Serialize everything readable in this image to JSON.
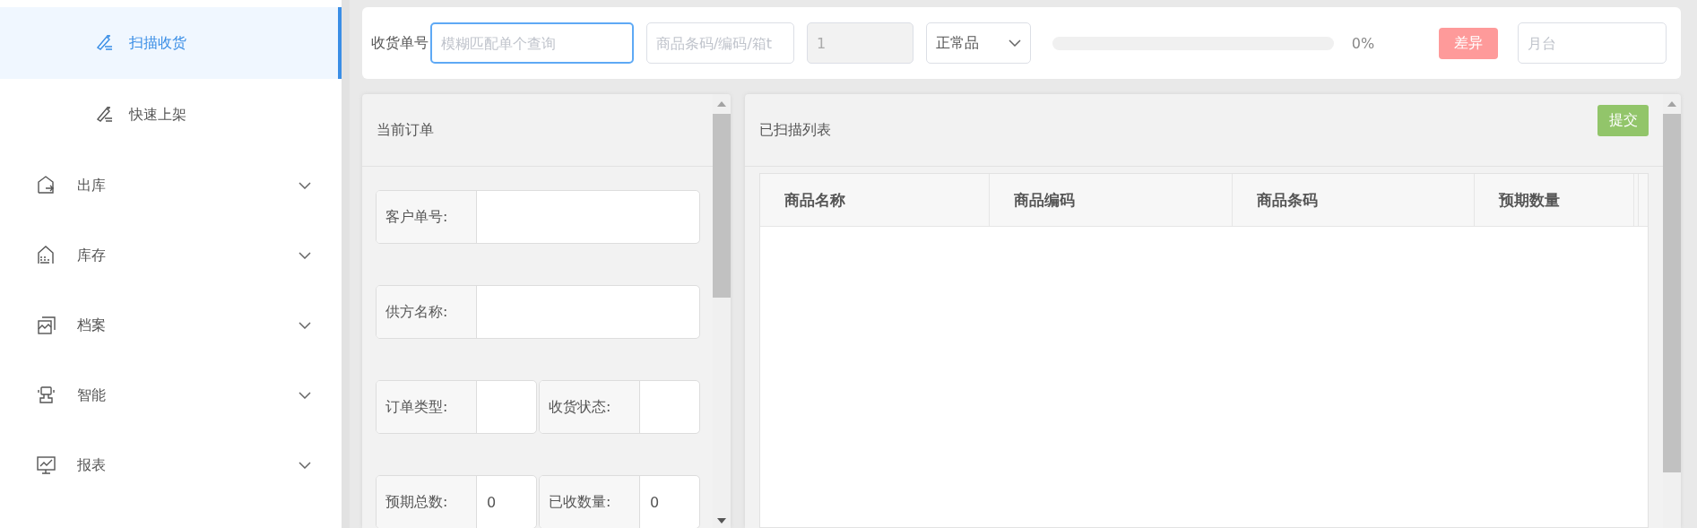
{
  "sidebar": {
    "items": [
      {
        "kind": "sub",
        "label": "扫描收货",
        "selected": true
      },
      {
        "kind": "sub",
        "label": "快速上架",
        "selected": false
      },
      {
        "kind": "group",
        "label": "出库",
        "selected": false,
        "expanded": false
      },
      {
        "kind": "group",
        "label": "库存",
        "selected": false,
        "expanded": false
      },
      {
        "kind": "group",
        "label": "档案",
        "selected": false,
        "expanded": false
      },
      {
        "kind": "group",
        "label": "智能",
        "selected": false,
        "expanded": false
      },
      {
        "kind": "group",
        "label": "报表",
        "selected": false,
        "expanded": false
      }
    ]
  },
  "toolbar": {
    "label": "收货单号",
    "fields": [
      {
        "kind": "input",
        "placeholder": "模糊匹配单个查询",
        "focused": true,
        "disabled": false
      },
      {
        "kind": "input",
        "placeholder": "商品条码/编码/箱t",
        "focused": false,
        "disabled": false
      },
      {
        "kind": "input",
        "value": "1",
        "focused": false,
        "disabled": true
      },
      {
        "kind": "select",
        "value": "正常品"
      }
    ],
    "progress": {
      "level": 0,
      "reading": "0%"
    },
    "diff_button": "差异",
    "dock_field": {
      "placeholder": "月台"
    }
  },
  "current_order": {
    "title": "当前订单",
    "rows": [
      {
        "fields": [
          {
            "label": "客户单号:"
          }
        ]
      },
      {
        "fields": [
          {
            "label": "供方名称:"
          }
        ]
      },
      {
        "fields": [
          {
            "label": "订单类型:"
          },
          {
            "label": "收货状态:"
          }
        ]
      },
      {
        "fields": [
          {
            "label": "预期总数:",
            "value": "0"
          },
          {
            "label": "已收数量:",
            "value": "0"
          }
        ]
      }
    ]
  },
  "scanned_list": {
    "title": "已扫描列表",
    "submit_button": "提交",
    "table": {
      "columns": [
        "商品名称",
        "商品编码",
        "商品条码",
        "预期数量"
      ]
    }
  }
}
